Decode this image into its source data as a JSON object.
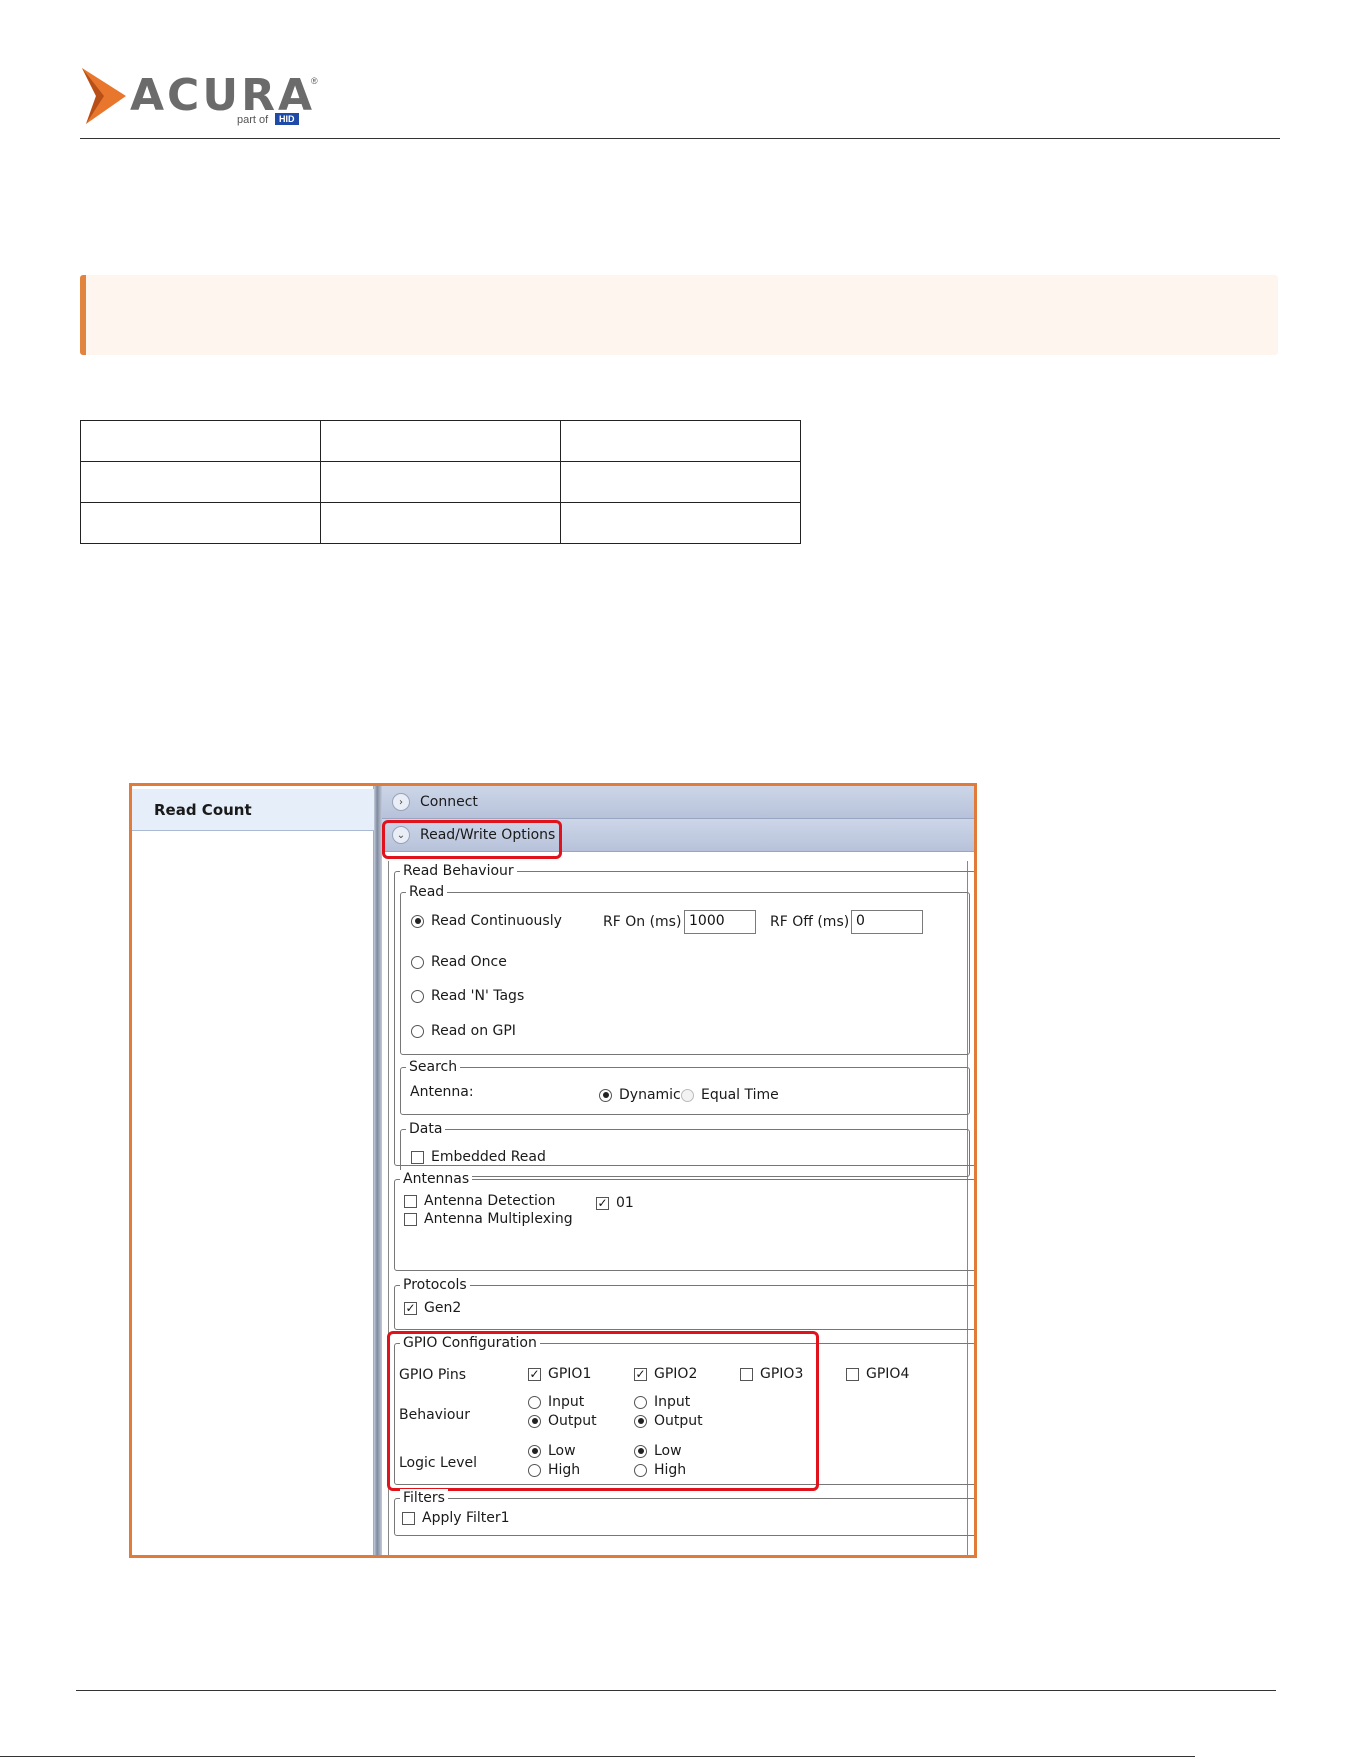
{
  "brand": {
    "name": "ACURA",
    "registered": "®",
    "part_of": "part of",
    "parent": "HID"
  },
  "app": {
    "sidebar": {
      "items": [
        {
          "label": "Read Count"
        }
      ]
    },
    "accordion": [
      {
        "label": "Connect",
        "icon": "chevron-right-icon"
      },
      {
        "label": "Read/Write Options",
        "icon": "chevron-down-icon"
      }
    ],
    "read_behaviour": {
      "title": "Read Behaviour",
      "read": {
        "title": "Read",
        "options": [
          "Read Continuously",
          "Read Once",
          "Read 'N' Tags",
          "Read on GPI"
        ],
        "selected": "Read Continuously",
        "rf_on_label": "RF On (ms)",
        "rf_on_value": "1000",
        "rf_off_label": "RF Off (ms)",
        "rf_off_value": "0"
      },
      "search": {
        "title": "Search",
        "antenna_label": "Antenna:",
        "options": [
          "Dynamic",
          "Equal Time"
        ],
        "selected": "Dynamic"
      },
      "data": {
        "title": "Data",
        "embedded_read": "Embedded Read"
      }
    },
    "antennas": {
      "title": "Antennas",
      "detection": "Antenna Detection",
      "multiplexing": "Antenna Multiplexing",
      "port": "01"
    },
    "protocols": {
      "title": "Protocols",
      "gen2": "Gen2"
    },
    "gpio": {
      "title": "GPIO Configuration",
      "pins_label": "GPIO Pins",
      "behaviour_label": "Behaviour",
      "logic_label": "Logic Level",
      "pins": [
        "GPIO1",
        "GPIO2",
        "GPIO3",
        "GPIO4"
      ],
      "input": "Input",
      "output": "Output",
      "low": "Low",
      "high": "High"
    },
    "filters": {
      "title": "Filters",
      "apply": "Apply Filter1"
    }
  },
  "colors": {
    "accent_orange": "#e07b39",
    "highlight_red": "#e0121b",
    "callout_bg": "#fdf5ee"
  }
}
